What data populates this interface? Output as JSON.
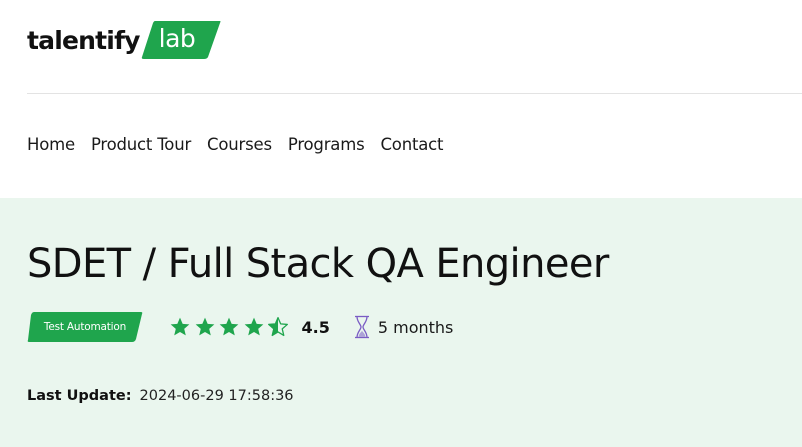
{
  "brand": {
    "name": "talentify",
    "badge": "lab",
    "accent_color": "#1fa54d"
  },
  "nav": {
    "items": [
      {
        "label": "Home"
      },
      {
        "label": "Product Tour"
      },
      {
        "label": "Courses"
      },
      {
        "label": "Programs"
      },
      {
        "label": "Contact"
      }
    ]
  },
  "course": {
    "title": "SDET / Full Stack QA Engineer",
    "tag": "Test Automation",
    "rating": "4.5",
    "rating_value": 4.5,
    "rating_max": 5,
    "star_color": "#1fa54d",
    "duration": "5 months",
    "duration_icon": "hourglass-icon",
    "last_update_label": "Last Update:",
    "last_update_value": "2024-06-29 17:58:36"
  },
  "colors": {
    "hero_background": "#eaf6ee",
    "hourglass": "#7a5cc4"
  }
}
